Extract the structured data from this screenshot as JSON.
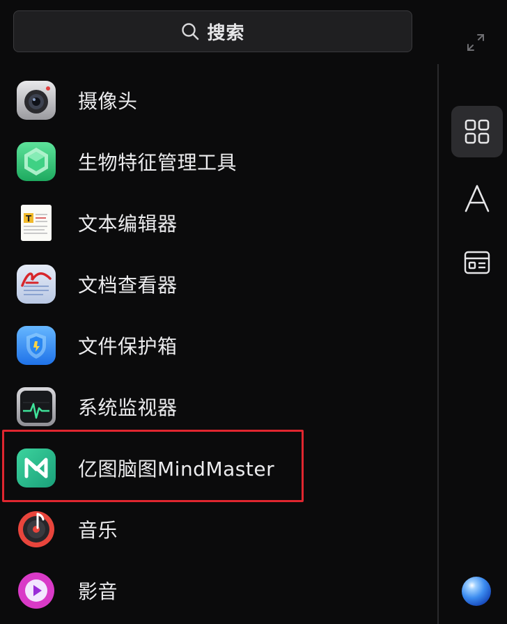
{
  "search": {
    "label": "搜索",
    "icon": "search-icon"
  },
  "apps": [
    {
      "label": "摄像头",
      "icon": "camera-icon"
    },
    {
      "label": "生物特征管理工具",
      "icon": "biometric-icon"
    },
    {
      "label": "文本编辑器",
      "icon": "text-editor-icon"
    },
    {
      "label": "文档查看器",
      "icon": "document-viewer-icon"
    },
    {
      "label": "文件保护箱",
      "icon": "file-vault-icon"
    },
    {
      "label": "系统监视器",
      "icon": "system-monitor-icon"
    },
    {
      "label": "亿图脑图MindMaster",
      "icon": "mindmaster-icon"
    },
    {
      "label": "音乐",
      "icon": "music-icon"
    },
    {
      "label": "影音",
      "icon": "video-icon"
    }
  ],
  "sidebar": {
    "buttons": [
      {
        "icon": "grid-view-icon",
        "active": true
      },
      {
        "icon": "alphabet-sort-icon",
        "active": false
      },
      {
        "icon": "category-view-icon",
        "active": false
      }
    ],
    "assistant": "assistant-orb-icon"
  },
  "highlight_color": "#e0262f"
}
